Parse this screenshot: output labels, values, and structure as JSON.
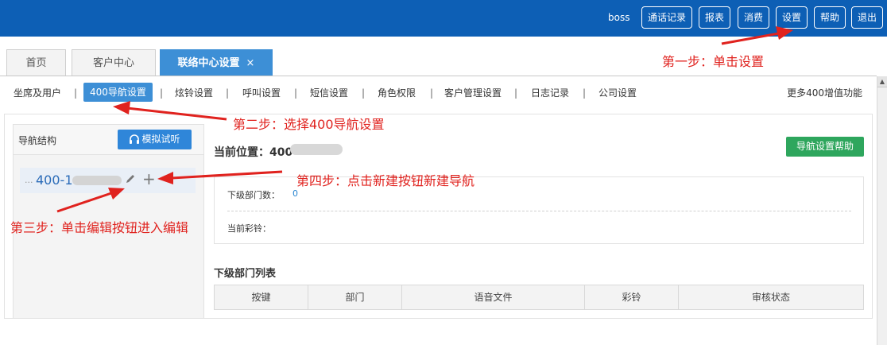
{
  "header": {
    "user": "boss",
    "buttons": [
      "通话记录",
      "报表",
      "消费",
      "设置",
      "帮助",
      "退出"
    ]
  },
  "tabs": [
    {
      "label": "首页"
    },
    {
      "label": "客户中心"
    },
    {
      "label": "联络中心设置",
      "close": "×"
    }
  ],
  "subnav": {
    "items": [
      "坐席及用户",
      "400导航设置",
      "炫铃设置",
      "呼叫设置",
      "短信设置",
      "角色权限",
      "客户管理设置",
      "日志记录",
      "公司设置"
    ],
    "separator": "|",
    "more": "更多400增值功能"
  },
  "left_panel": {
    "title": "导航结构",
    "listen_button": "模拟试听",
    "tree_number_prefix": "400-1",
    "tree_dots": "...",
    "add_symbol": "+"
  },
  "main": {
    "location_label": "当前位置：400",
    "help_button": "导航设置帮助",
    "sub_dept_count_label": "下级部门数：",
    "sub_dept_count_value": "0",
    "current_ringtone_label": "当前彩铃：",
    "list_title": "下级部门列表",
    "columns": [
      "按键",
      "部门",
      "语音文件",
      "彩铃",
      "审核状态"
    ]
  },
  "annotations": {
    "step1": "第一步：单击设置",
    "step2": "第二步：选择400导航设置",
    "step3": "第三步：单击编辑按钮进入编辑",
    "step4": "第四步：点击新建按钮新建导航"
  },
  "colors": {
    "topbar": "#0d5fb5",
    "accent": "#3d8fd6",
    "help_button": "#2ea65d",
    "annotation": "#e0221e"
  }
}
